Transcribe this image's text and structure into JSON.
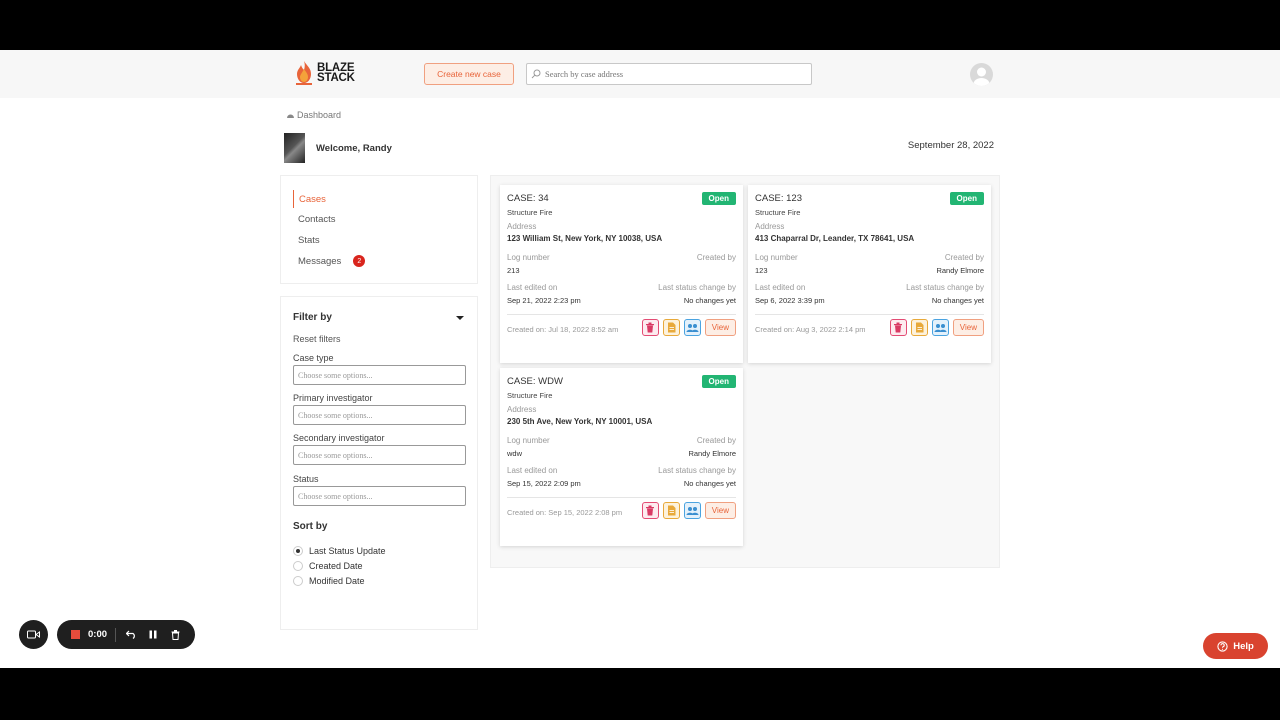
{
  "header": {
    "logo_line1": "BLAZE",
    "logo_line2": "STACK",
    "create_button": "Create new case",
    "search_placeholder": "Search by case address"
  },
  "breadcrumb": "Dashboard",
  "welcome": "Welcome, Randy",
  "date": "September 28, 2022",
  "nav": {
    "items": [
      {
        "label": "Cases"
      },
      {
        "label": "Contacts"
      },
      {
        "label": "Stats"
      },
      {
        "label": "Messages",
        "badge": "2"
      }
    ]
  },
  "filter": {
    "title": "Filter by",
    "reset": "Reset filters",
    "fields": [
      {
        "label": "Case type",
        "placeholder": "Choose some options..."
      },
      {
        "label": "Primary investigator",
        "placeholder": "Choose some options..."
      },
      {
        "label": "Secondary investigator",
        "placeholder": "Choose some options..."
      },
      {
        "label": "Status",
        "placeholder": "Choose some options..."
      }
    ],
    "sort_title": "Sort by",
    "sort_options": [
      {
        "label": "Last Status Update",
        "checked": true
      },
      {
        "label": "Created Date",
        "checked": false
      },
      {
        "label": "Modified Date",
        "checked": false
      }
    ]
  },
  "card_labels": {
    "address": "Address",
    "log_number": "Log number",
    "created_by": "Created by",
    "last_edited": "Last edited on",
    "last_status": "Last status change by",
    "view": "View"
  },
  "cases": [
    {
      "title": "CASE:  34",
      "status": "Open",
      "type": "Structure Fire",
      "address": "123 William St, New York, NY 10038, USA",
      "log_number": "213",
      "created_by": "",
      "last_edited": "Sep 21, 2022 2:23 pm",
      "last_status": "No changes yet",
      "created_on": "Created on: Jul 18, 2022 8:52 am"
    },
    {
      "title": "CASE:  123",
      "status": "Open",
      "type": "Structure Fire",
      "address": "413 Chaparral Dr, Leander, TX 78641, USA",
      "log_number": "123",
      "created_by": "Randy Elmore",
      "last_edited": "Sep 6, 2022 3:39 pm",
      "last_status": "No changes yet",
      "created_on": "Created on: Aug 3, 2022 2:14 pm"
    },
    {
      "title": "CASE:  WDW",
      "status": "Open",
      "type": "Structure Fire",
      "address": "230 5th Ave, New York, NY 10001, USA",
      "log_number": "wdw",
      "created_by": "Randy Elmore",
      "last_edited": "Sep 15, 2022 2:09 pm",
      "last_status": "No changes yet",
      "created_on": "Created on: Sep 15, 2022 2:08 pm"
    }
  ],
  "recorder": {
    "time": "0:00"
  },
  "help": "Help",
  "colors": {
    "accent": "#e8643a",
    "open_badge": "#22b573",
    "help": "#d9432f",
    "notification": "#d9251d"
  }
}
